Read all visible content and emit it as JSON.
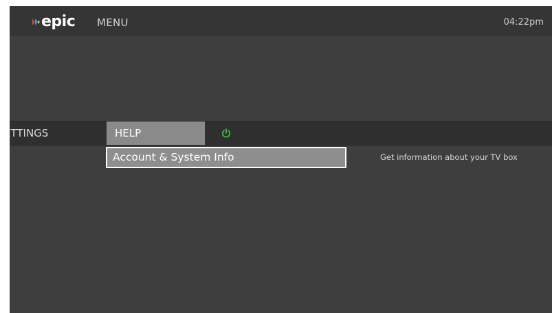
{
  "header": {
    "logo_text": "epic",
    "title": "MENU",
    "clock": "04:22pm"
  },
  "tabs": [
    {
      "label": "ETTINGS",
      "selected": false
    },
    {
      "label": "HELP",
      "selected": true
    }
  ],
  "power_icon": {
    "name": "power-icon",
    "color": "#3bbf3b"
  },
  "submenu": {
    "items": [
      {
        "label": "Account & System Info",
        "selected": true
      }
    ]
  },
  "description": "Get information about your TV box",
  "colors": {
    "logo_red": "#e23b3b",
    "logo_blue": "#2e9fd8",
    "logo_yellow": "#f2c230",
    "selected_tab": "#8a8a8a",
    "background": "#3e3e3e"
  }
}
